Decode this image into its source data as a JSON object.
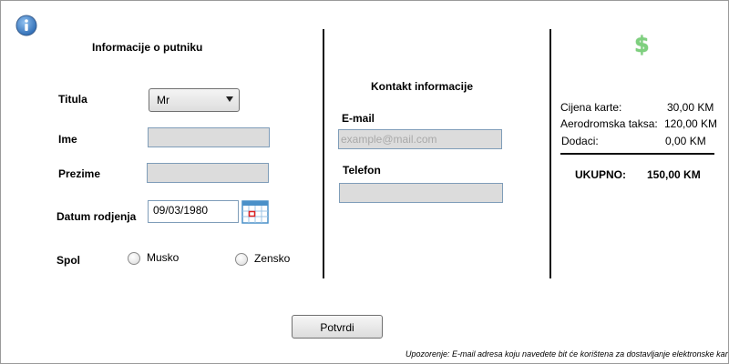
{
  "passenger": {
    "title": "Informacije o putniku",
    "title_label": "Titula",
    "title_select_value": "Mr",
    "first_name_label": "Ime",
    "first_name_value": "",
    "last_name_label": "Prezime",
    "last_name_value": "",
    "birth_date_label": "Datum rodjenja",
    "birth_date_value": "09/03/1980",
    "gender_label": "Spol",
    "gender_options": [
      "Musko",
      "Zensko"
    ]
  },
  "contact": {
    "title": "Kontakt informacije",
    "email_label": "E-mail",
    "email_placeholder": "example@mail.com",
    "phone_label": "Telefon",
    "phone_value": ""
  },
  "pricing": {
    "rows": [
      {
        "label": "Cijena karte:",
        "value": "30,00 KM"
      },
      {
        "label": "Aerodromska taksa:",
        "value": "120,00 KM"
      },
      {
        "label": "Dodaci:",
        "value": "0,00 KM"
      }
    ],
    "total_label": "UKUPNO:",
    "total_value": "150,00 KM"
  },
  "icons": {
    "info": "info-icon",
    "calendar": "calendar-icon",
    "dollar": "dollar-icon",
    "dollar_symbol": "$"
  },
  "colors": {
    "input_bg": "#dcdcdc",
    "input_border": "#7f9db9",
    "dollar_green": "#7ed07e",
    "info_blue": "#2f6db5"
  },
  "confirm_button": "Potvrdi",
  "warning": "Upozorenje: E-mail adresa koju navedete bit će korištena za dostavljanje elektronske kar"
}
